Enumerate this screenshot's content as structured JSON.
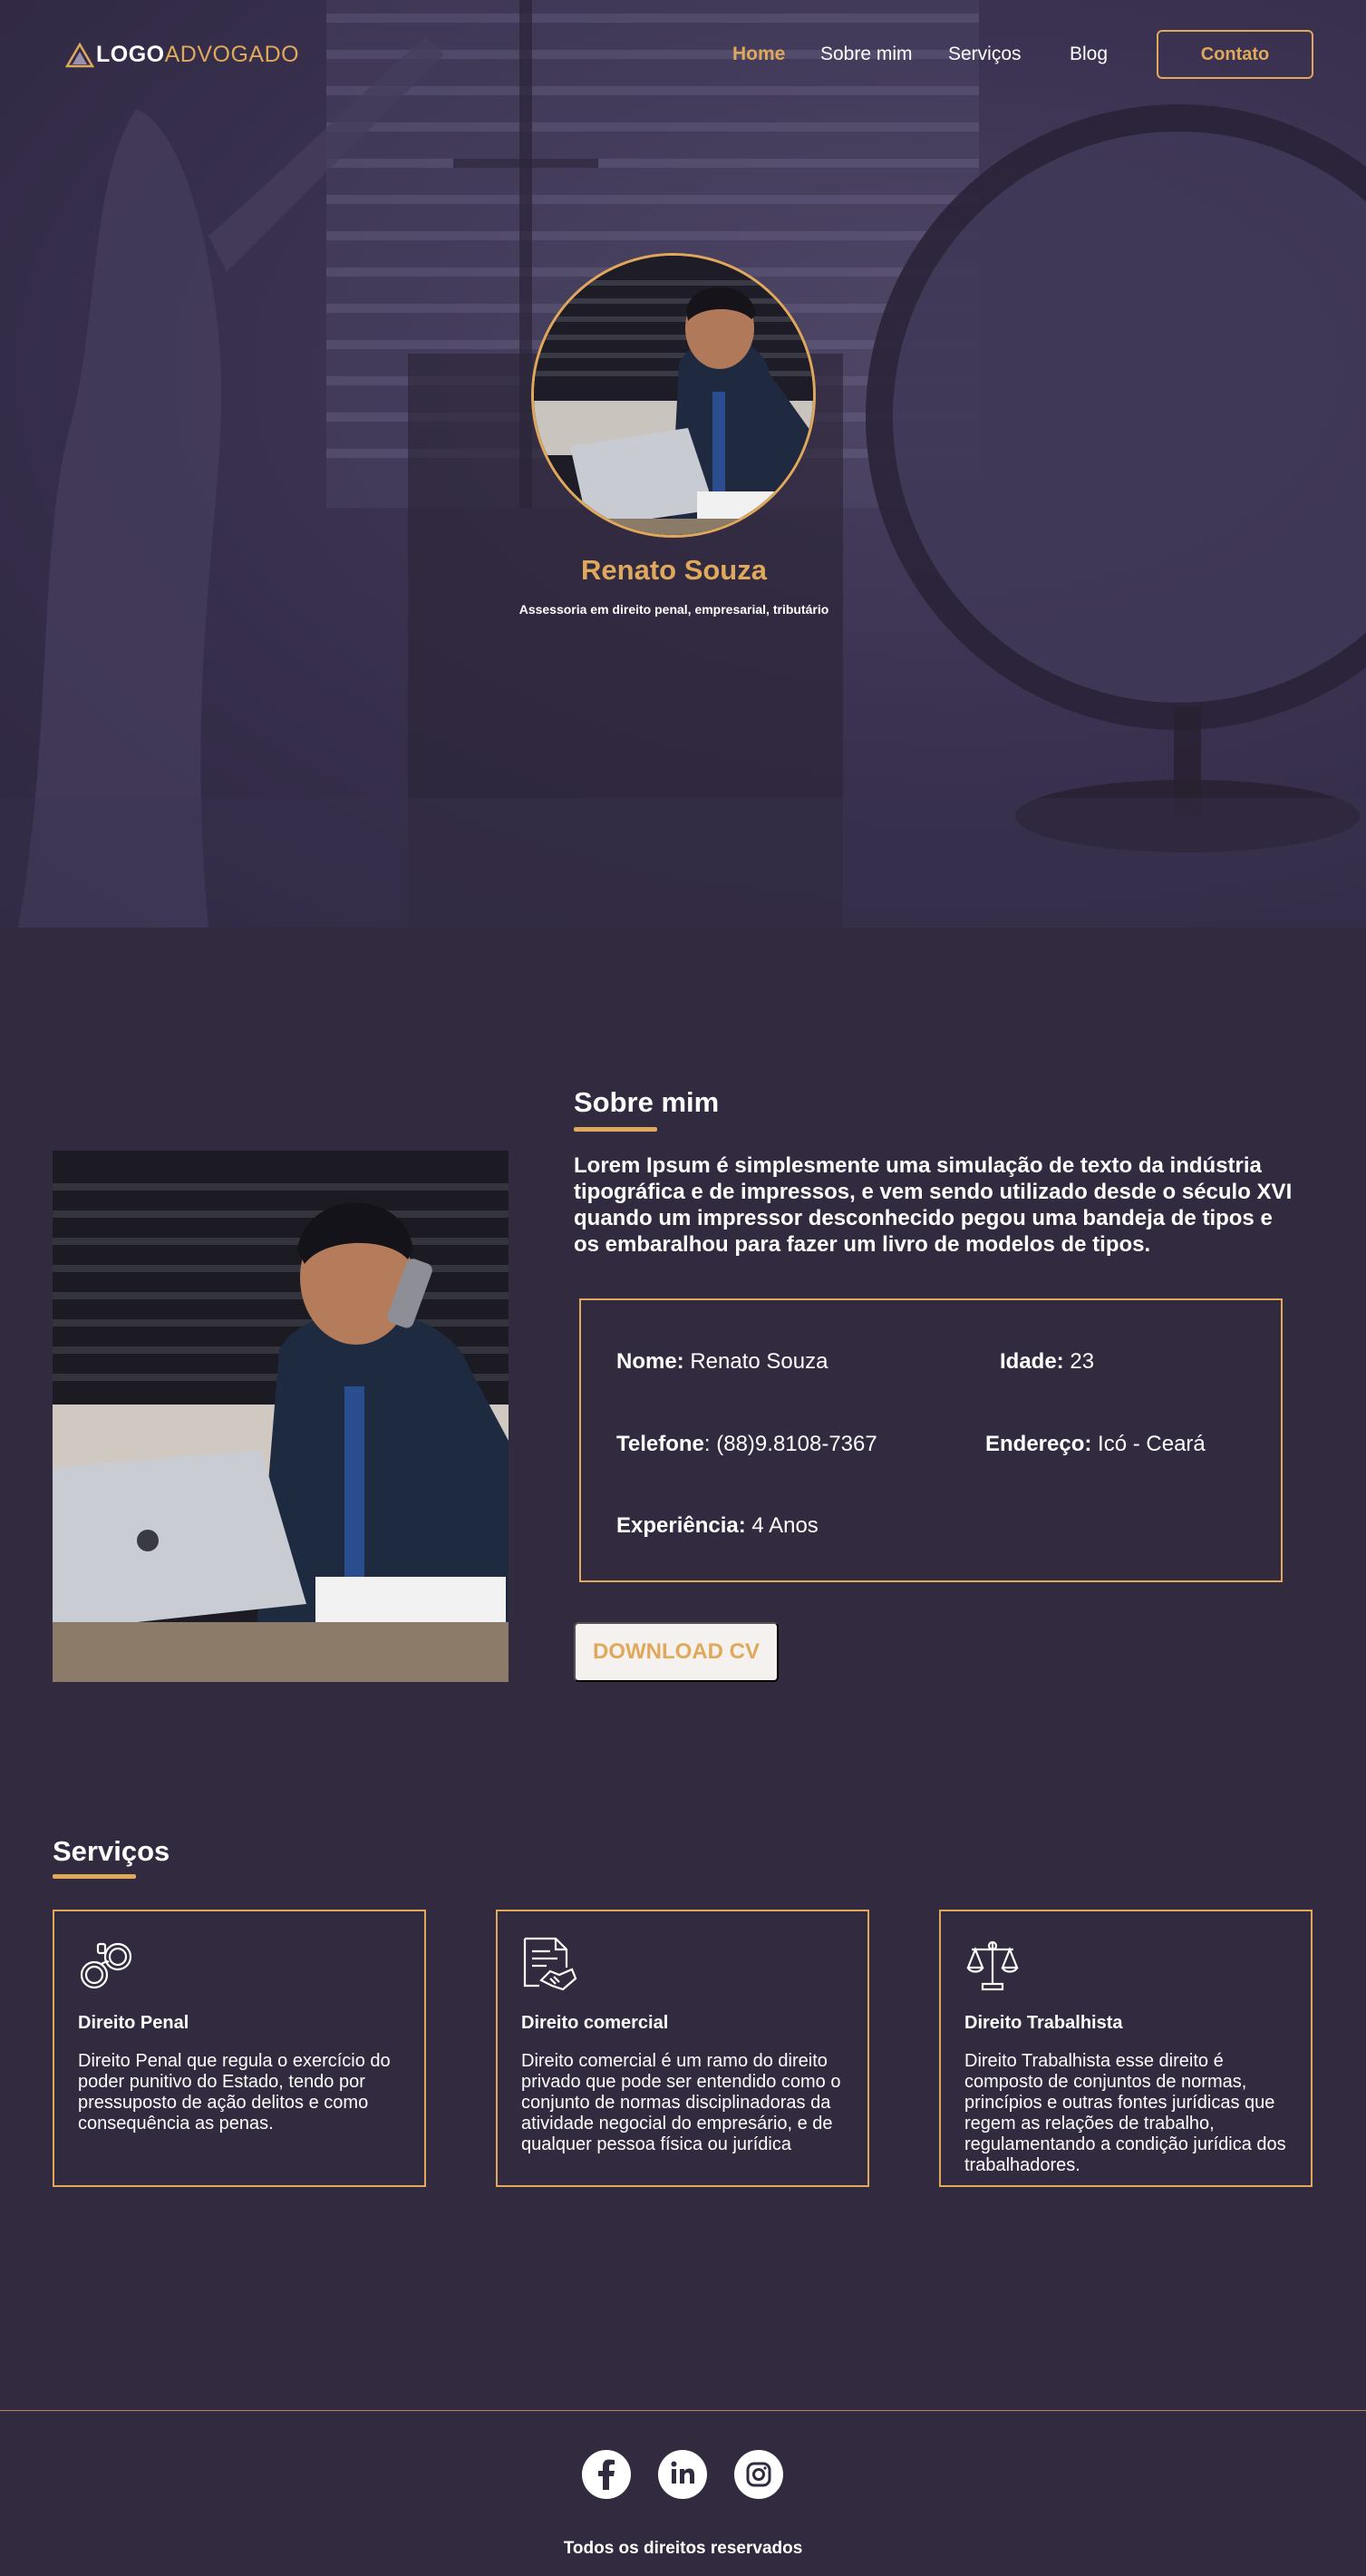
{
  "nav": {
    "logo_part1": "LOGO",
    "logo_part2": "ADVOGADO",
    "links": [
      "Home",
      "Sobre mim",
      "Serviços",
      "Blog"
    ],
    "active_link": "Home",
    "contact_label": "Contato"
  },
  "hero": {
    "name": "Renato Souza",
    "subtitle": "Assessoria em direito penal, empresarial, tributário"
  },
  "about": {
    "title": "Sobre mim",
    "text": "Lorem Ipsum é simplesmente uma simulação de texto da indústria tipográfica e de impressos, e vem sendo utilizado desde o século XVI quando um impressor desconhecido pegou uma bandeja de tipos e os embaralhou para fazer um livro de modelos de tipos.",
    "fields": {
      "nome_label": "Nome:",
      "nome_value": " Renato Souza",
      "idade_label": "Idade:",
      "idade_value": " 23",
      "telefone_label": "Telefone",
      "telefone_value": ": (88)9.8108-7367",
      "endereco_label": "Endereço:",
      "endereco_value": " Icó - Ceará",
      "experiencia_label": "Experiência:",
      "experiencia_value": " 4 Anos"
    },
    "download_label": "DOWNLOAD CV"
  },
  "services": {
    "title": "Serviços",
    "cards": [
      {
        "icon": "handcuffs-icon",
        "title": "Direito Penal",
        "description": "Direito Penal que regula o exercício do poder punitivo do Estado, tendo por pressuposto de ação delitos e como consequência as penas."
      },
      {
        "icon": "contract-handshake-icon",
        "title": "Direito comercial",
        "description": "Direito comercial é um ramo do direito privado que pode ser entendido como o conjunto de normas disciplinadoras da atividade negocial do empresário, e de qualquer pessoa física ou jurídica"
      },
      {
        "icon": "scales-icon",
        "title": "Direito Trabalhista",
        "description": "Direito Trabalhista esse direito é composto de conjuntos de normas, princípios e outras fontes jurídicas que regem as relações de trabalho, regulamentando a condição jurídica dos trabalhadores."
      }
    ]
  },
  "footer": {
    "social": [
      "facebook-icon",
      "linkedin-icon",
      "instagram-icon"
    ],
    "copyright": "Todos os direitos reservados"
  },
  "colors": {
    "background": "#322a3f",
    "accent": "#e0a85a",
    "text": "#ffffff"
  }
}
